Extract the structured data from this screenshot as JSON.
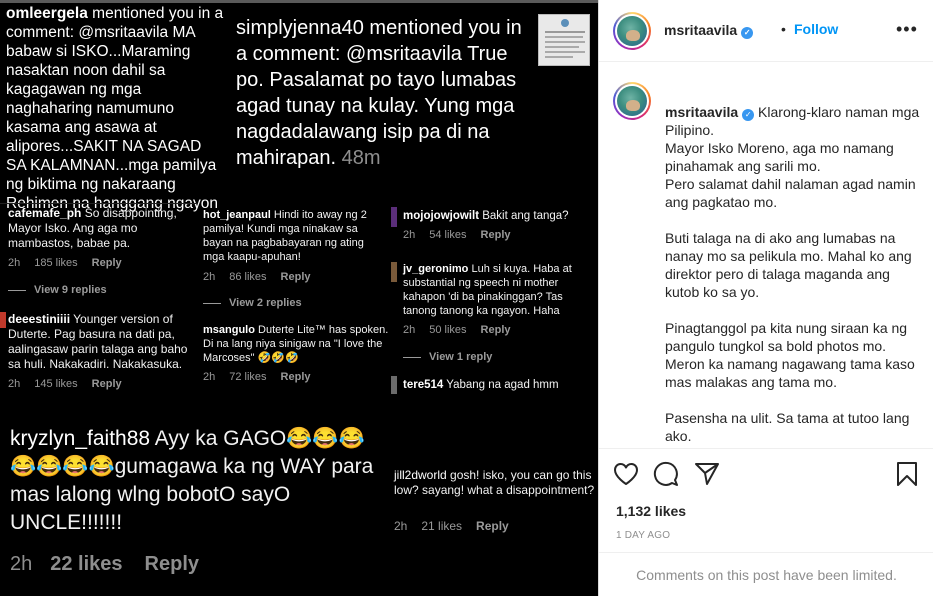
{
  "collage": {
    "top_left": {
      "user": "omleergela",
      "text": " mentioned you in a comment: @msritaavila MA babaw si ISKO...Maraming nasaktan noon dahil sa kagagawan ng mga naghaharing namumuno kasama ang asawa at alipores...SAKIT NA SAGAD SA KALAMNAN...mga pamilya ng biktima ng nakaraang Rehimen na hanggang ngayon"
    },
    "top_right": {
      "user": "simplyjenna40",
      "text": " mentioned you in a comment: @msritaavila True po. Pasalamat po tayo lumabas agad tunay na kulay. Yung mga nagdadalawang isip pa di na mahirapan.",
      "time": "48m"
    },
    "comments": [
      {
        "user": "cafemafe_ph",
        "text": " So disappointing, Mayor Isko. Ang aga mo mambastos, babae pa.",
        "time": "2h",
        "likes": "185 likes",
        "reply": "Reply",
        "view": "View 9 replies"
      },
      {
        "user": "hot_jeanpaul",
        "text": " Hindi ito away ng 2 pamilya! Kundi mga ninakaw sa bayan na pagbabayaran ng ating mga kaapu-apuhan!",
        "time": "2h",
        "likes": "86 likes",
        "reply": "Reply",
        "view": "View 2 replies"
      },
      {
        "user": "mojojowjowilt",
        "text": " Bakit ang tanga?",
        "time": "2h",
        "likes": "54 likes",
        "reply": "Reply"
      },
      {
        "user": "jv_geronimo",
        "text": " Luh si kuya. Haba at substantial ng speech ni mother kahapon 'di ba pinakinggan? Tas tanong tanong ka ngayon. Haha",
        "time": "2h",
        "likes": "50 likes",
        "reply": "Reply",
        "view": "View 1 reply"
      },
      {
        "user": "deeestiniiii",
        "text": " Younger version of Duterte. Pag basura na dati pa, aalingasaw parin talaga ang baho sa huli. Nakakadiri. Nakakasuka.",
        "time": "2h",
        "likes": "145 likes",
        "reply": "Reply"
      },
      {
        "user": "msangulo",
        "text": " Duterte Lite™ has spoken. Di na lang niya sinigaw na \"I love the Marcoses\" 🤣🤣🤣",
        "time": "2h",
        "likes": "72 likes",
        "reply": "Reply"
      },
      {
        "user": "tere514",
        "text": " Yabang na agad hmm"
      },
      {
        "user": "jill2dworld",
        "text": " gosh! isko, you can go this low? sayang! what a disappointment?",
        "time": "2h",
        "likes": "21 likes",
        "reply": "Reply"
      }
    ],
    "big": {
      "user": "kryzlyn_faith88",
      "text": " Ayy ka GAGO😂😂😂😂😂😂😂gumagawa ka ng WAY para mas lalong wlng bobotO sayO UNCLE!!!!!!!",
      "time": "2h",
      "likes": "22 likes",
      "reply": "Reply"
    }
  },
  "post": {
    "username": "msritaavila",
    "follow": "Follow",
    "more_icon": "more-icon",
    "caption_user": "msritaavila",
    "caption": " Klarong-klaro naman mga Pilipino.\nMayor Isko Moreno, aga mo namang pinahamak ang sarili mo.\nPero salamat dahil nalaman agad namin ang pagkatao mo.\n\nButi talaga na di ako ang lumabas na nanay mo sa pelikula mo. Mahal ko ang direktor pero di talaga maganda ang kutob ko sa yo.\n\nPinagtanggol pa kita nung siraan ka ng pangulo tungkol sa bold photos mo. Meron ka namang nagawang tama kaso mas malakas ang tama mo.\n\nPasensha na ulit. Sa tama at tutoo lang ako.",
    "likes": "1,132 likes",
    "date": "1 DAY AGO",
    "limited": "Comments on this post have been limited.",
    "icons": [
      "heart-icon",
      "comment-icon",
      "share-icon",
      "bookmark-icon"
    ],
    "colors": {
      "link": "#0095f6",
      "verified": "#3897f0",
      "text": "#262626",
      "muted": "#8e8e8e"
    }
  }
}
